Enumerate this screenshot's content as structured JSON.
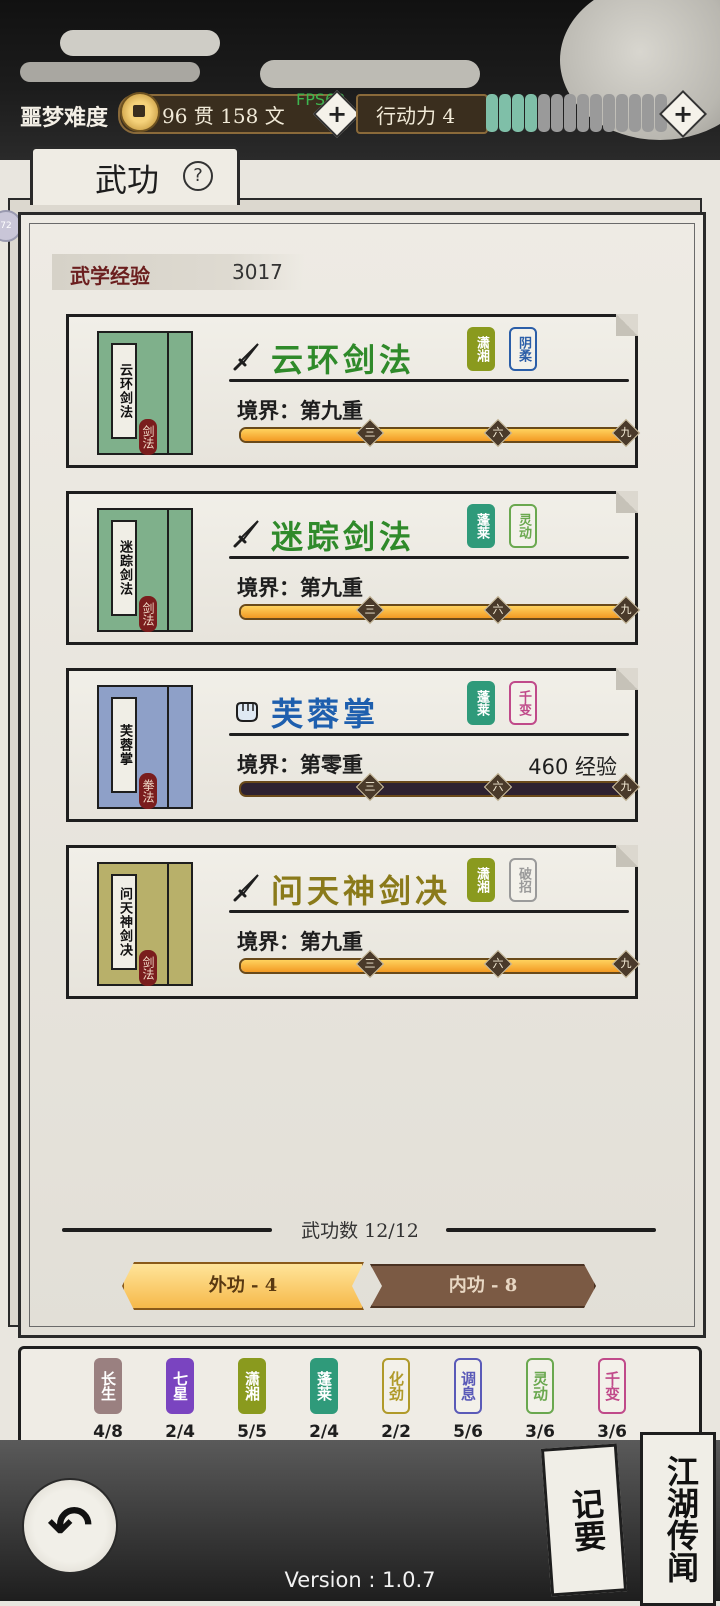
{
  "header": {
    "difficulty": "噩梦难度",
    "money_text": "96 贯  158  文",
    "fps_text": "FPS60",
    "action_label": "行动力 4",
    "energy": {
      "filled": 4,
      "total": 14
    }
  },
  "tab": {
    "title": "武功",
    "help": "?"
  },
  "left_badge": "72",
  "experience": {
    "label": "武学经验",
    "value": "3017"
  },
  "skills": [
    {
      "book_label": "云环剑法",
      "book_stamp": "剑法",
      "book_color": "#7fb08b",
      "icon": "sword-icon",
      "name": "云环剑法",
      "name_color": "#2f8a2a",
      "tags": [
        {
          "text": "潇湘",
          "color": "#8a9a1e",
          "outline": false
        },
        {
          "text": "阴柔",
          "color": "#2b5ea8",
          "outline": true
        }
      ],
      "realm": "境界：第九重",
      "exp_note": "",
      "progress": 1.0,
      "markers": [
        "三",
        "六",
        "九"
      ]
    },
    {
      "book_label": "迷踪剑法",
      "book_stamp": "剑法",
      "book_color": "#7fb08b",
      "icon": "sword-icon",
      "name": "迷踪剑法",
      "name_color": "#2f8a2a",
      "tags": [
        {
          "text": "蓬莱",
          "color": "#2f9a7a",
          "outline": false
        },
        {
          "text": "灵动",
          "color": "#6aa84f",
          "outline": true
        }
      ],
      "realm": "境界：第九重",
      "exp_note": "",
      "progress": 1.0,
      "markers": [
        "三",
        "六",
        "九"
      ]
    },
    {
      "book_label": "芙蓉掌",
      "book_stamp": "拳法",
      "book_color": "#8ea0c8",
      "icon": "fist-icon",
      "name": "芙蓉掌",
      "name_color": "#1e5fae",
      "tags": [
        {
          "text": "蓬莱",
          "color": "#2f9a7a",
          "outline": false
        },
        {
          "text": "千变",
          "color": "#c04a8a",
          "outline": true
        }
      ],
      "realm": "境界：第零重",
      "exp_note": "460 经验",
      "progress": 0.0,
      "markers": [
        "三",
        "六",
        "九"
      ]
    },
    {
      "book_label": "问天神剑决",
      "book_stamp": "剑法",
      "book_color": "#b8b06a",
      "icon": "sword-icon",
      "name": "问天神剑决",
      "name_color": "#8a7a1a",
      "tags": [
        {
          "text": "潇湘",
          "color": "#8a9a1e",
          "outline": false
        },
        {
          "text": "破招",
          "color": "#9a9a9a",
          "outline": true
        }
      ],
      "realm": "境界：第九重",
      "exp_note": "",
      "progress": 1.0,
      "markers": [
        "三",
        "六",
        "九"
      ]
    }
  ],
  "count_text": "武功数 12/12",
  "buttons": {
    "external": "外功 - 4",
    "internal": "内功 - 8"
  },
  "schools": [
    {
      "name": "长生",
      "color": "#9a8080",
      "outline": false,
      "count": "4/8",
      "pips_on": 1,
      "pips_total": 2
    },
    {
      "name": "七星",
      "color": "#7a44c0",
      "outline": false,
      "count": "2/4",
      "pips_on": 1,
      "pips_total": 2
    },
    {
      "name": "潇湘",
      "color": "#8a9a1e",
      "outline": false,
      "count": "5/5",
      "pips_on": 2,
      "pips_total": 2
    },
    {
      "name": "蓬莱",
      "color": "#2f9a7a",
      "outline": false,
      "count": "2/4",
      "pips_on": 1,
      "pips_total": 2
    },
    {
      "name": "化劲",
      "color": "#b09a2a",
      "outline": true,
      "count": "2/2",
      "pips_on": 1,
      "pips_total": 1
    },
    {
      "name": "调息",
      "color": "#5a5ab8",
      "outline": true,
      "count": "5/6",
      "pips_on": 2,
      "pips_total": 3
    },
    {
      "name": "灵动",
      "color": "#6aa84f",
      "outline": true,
      "count": "3/6",
      "pips_on": 1,
      "pips_total": 3
    },
    {
      "name": "千变",
      "color": "#c04a8a",
      "outline": true,
      "count": "3/6",
      "pips_on": 1,
      "pips_total": 3
    }
  ],
  "bottom": {
    "back_glyph": "↶",
    "note_card": "记要",
    "news_card": "江湖传闻",
    "version": "Version : 1.0.7"
  },
  "colors": {
    "pip_on": "#3aa4d8",
    "pip_off": "#9a9a9a",
    "energy_on": "#7fbfa8",
    "energy_off": "#9a9a9a"
  }
}
